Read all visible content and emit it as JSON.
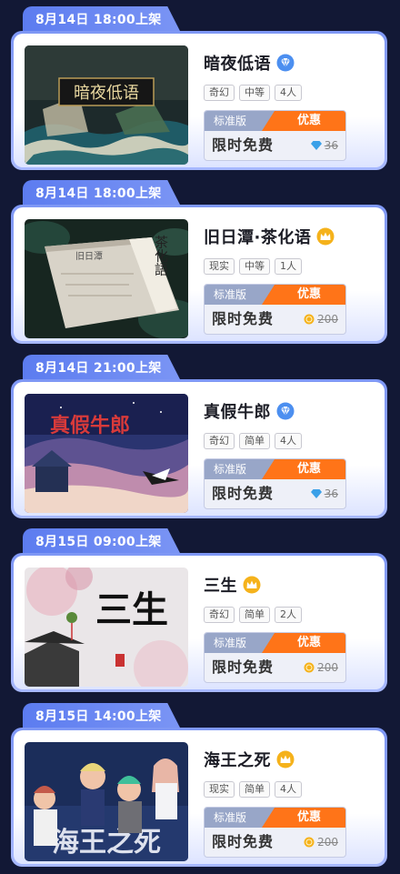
{
  "entries": [
    {
      "date": "8月14日 18:00上架",
      "title": "暗夜低语",
      "badge_icon": "diamond-badge-icon",
      "tags": [
        "奇幻",
        "中等",
        "4人"
      ],
      "price_label": "标准版",
      "sale_label": "优惠",
      "free_label": "限时免费",
      "currency_icon": "diamond-icon",
      "original_price": "36",
      "cover_text": "暗夜低语"
    },
    {
      "date": "8月14日 18:00上架",
      "title": "旧日潭·茶化语",
      "badge_icon": "crown-badge-icon",
      "tags": [
        "现实",
        "中等",
        "1人"
      ],
      "price_label": "标准版",
      "sale_label": "优惠",
      "free_label": "限时免费",
      "currency_icon": "coin-icon",
      "original_price": "200",
      "cover_text": "茶化語",
      "cover_subtext": "旧日潭"
    },
    {
      "date": "8月14日 21:00上架",
      "title": "真假牛郎",
      "badge_icon": "diamond-badge-icon",
      "tags": [
        "奇幻",
        "简单",
        "4人"
      ],
      "price_label": "标准版",
      "sale_label": "优惠",
      "free_label": "限时免费",
      "currency_icon": "diamond-icon",
      "original_price": "36",
      "cover_text": "真假牛郎"
    },
    {
      "date": "8月15日 09:00上架",
      "title": "三生",
      "badge_icon": "crown-badge-icon",
      "tags": [
        "奇幻",
        "简单",
        "2人"
      ],
      "price_label": "标准版",
      "sale_label": "优惠",
      "free_label": "限时免费",
      "currency_icon": "coin-icon",
      "original_price": "200",
      "cover_text": "三生"
    },
    {
      "date": "8月15日 14:00上架",
      "title": "海王之死",
      "badge_icon": "crown-badge-icon",
      "tags": [
        "现实",
        "简单",
        "4人"
      ],
      "price_label": "标准版",
      "sale_label": "优惠",
      "free_label": "限时免费",
      "currency_icon": "coin-icon",
      "original_price": "200",
      "cover_text": "海王之死"
    }
  ],
  "colors": {
    "background": "#121835",
    "tab": "#6b86f2",
    "sale": "#ff7418",
    "standard": "#98a6c8",
    "diamond": "#3aa0e8",
    "coin": "#f5b21b"
  }
}
